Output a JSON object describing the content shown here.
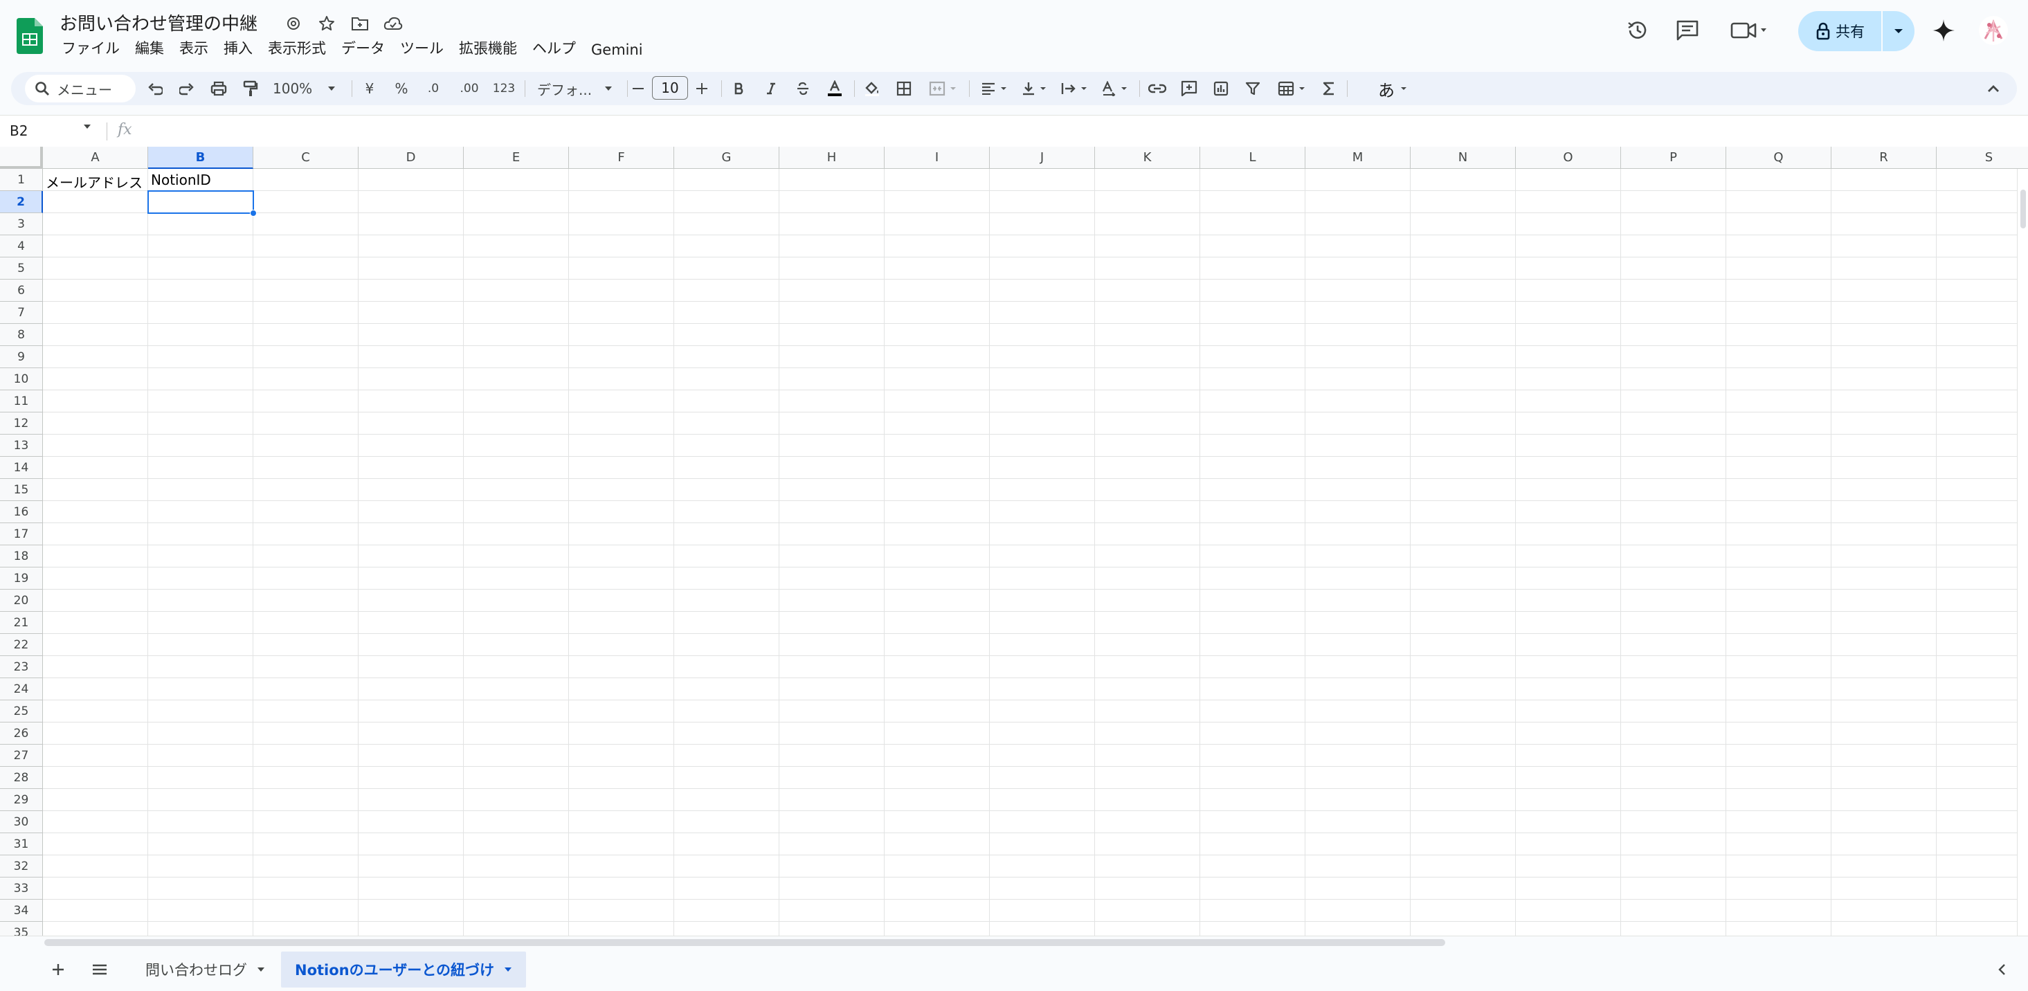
{
  "doc": {
    "title": "お問い合わせ管理の中継"
  },
  "menu": [
    "ファイル",
    "編集",
    "表示",
    "挿入",
    "表示形式",
    "データ",
    "ツール",
    "拡張機能",
    "ヘルプ",
    "Gemini"
  ],
  "share": {
    "label": "共有"
  },
  "toolbar": {
    "search_label": "メニュー",
    "zoom": "100%",
    "currency": "¥",
    "percent": "%",
    "decrease_decimal": ".0",
    "increase_decimal": ".00",
    "number_format": "123",
    "font": "デフォ...",
    "font_size": "10",
    "input_tool": "あ"
  },
  "formula_bar": {
    "name_box": "B2",
    "fx": "fx",
    "value": ""
  },
  "grid": {
    "columns": [
      "A",
      "B",
      "C",
      "D",
      "E",
      "F",
      "G",
      "H",
      "I",
      "J",
      "K",
      "L",
      "M",
      "N",
      "O",
      "P",
      "Q",
      "R",
      "S"
    ],
    "rows": [
      "1",
      "2",
      "3",
      "4",
      "5",
      "6",
      "7",
      "8",
      "9",
      "10",
      "11",
      "12",
      "13",
      "14",
      "15",
      "16",
      "17",
      "18",
      "19",
      "20",
      "21",
      "22",
      "23",
      "24",
      "25",
      "26",
      "27",
      "28",
      "29",
      "30",
      "31",
      "32",
      "33",
      "34",
      "35"
    ],
    "selected_cell": "B2",
    "cells": {
      "A1": "メールアドレス",
      "B1": "NotionID"
    }
  },
  "sheets": {
    "tabs": [
      {
        "label": "問い合わせログ",
        "active": false
      },
      {
        "label": "Notionのユーザーとの紐づけ",
        "active": true
      }
    ]
  },
  "colors": {
    "accent": "#0b57d0",
    "share_bg": "#c2e7ff",
    "selection": "#1a73e8"
  },
  "icons": [
    "sheets-logo-icon",
    "move-icon",
    "star-icon",
    "folder-icon",
    "cloud-icon",
    "history-icon",
    "comment-icon",
    "meet-icon",
    "lock-icon",
    "gemini-icon",
    "avatar"
  ]
}
